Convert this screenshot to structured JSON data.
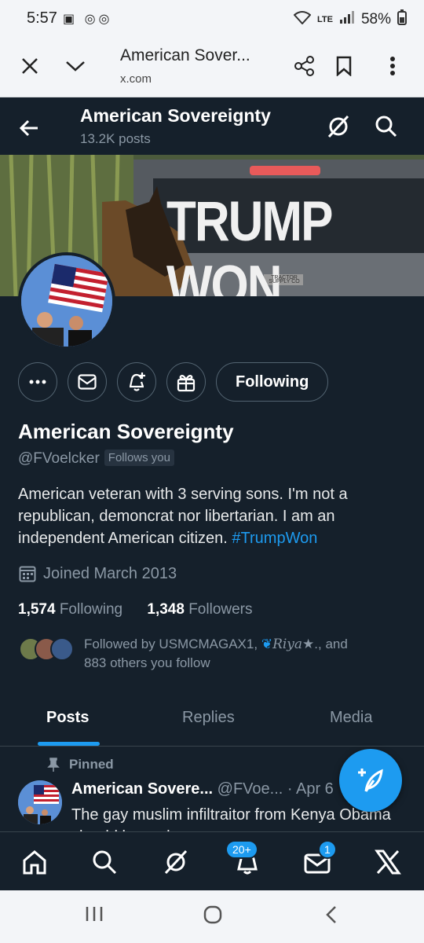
{
  "status_bar": {
    "time": "5:57",
    "battery": "58%",
    "network": "LTE"
  },
  "browser": {
    "title": "American Sover...",
    "url": "x.com"
  },
  "header": {
    "name": "American Sovereignty",
    "post_count": "13.2K posts"
  },
  "banner": {
    "text": "TRUMP WON",
    "badge": "TRACTOR SUPPLY CO"
  },
  "profile": {
    "name": "American Sovereignty",
    "handle": "@FVoelcker",
    "follows_you": "Follows you",
    "following_button": "Following",
    "bio_text": "American veteran with 3 serving sons. I'm not a republican, demoncrat nor libertarian. I am an independent American citizen. ",
    "bio_hashtag": "#TrumpWon",
    "joined": "Joined March 2013",
    "following_count": "1,574",
    "following_label": "Following",
    "followers_count": "1,348",
    "followers_label": "Followers",
    "followed_by_prefix": "Followed by USMCMAGAX1,",
    "followed_by_name2": "Riya",
    "followed_by_suffix": "★., and",
    "followed_by_line2": "883 others you follow"
  },
  "tabs": [
    {
      "label": "Posts"
    },
    {
      "label": "Replies"
    },
    {
      "label": "Media"
    }
  ],
  "post": {
    "pinned_label": "Pinned",
    "author": "American Sovere...",
    "handle": "@FVoe...",
    "date": "· Apr 6",
    "text": "The gay muslim infiltraitor from Kenya Obama should be unde..."
  },
  "bottom_nav": {
    "notifications_badge": "20+",
    "messages_badge": "1"
  },
  "colors": {
    "background": "#15202b",
    "accent": "#1d9bf0",
    "muted": "#8b98a5"
  }
}
